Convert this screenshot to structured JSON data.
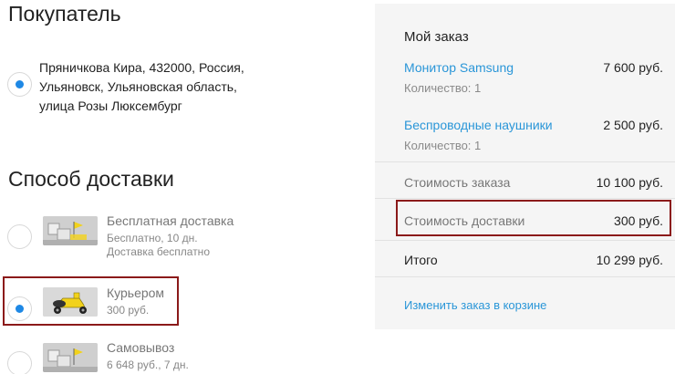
{
  "buyer": {
    "title": "Покупатель",
    "address": "Пряничкова Кира, 432000, Россия, Ульяновск, Ульяновская область, улица Розы Люксембург",
    "selected": true
  },
  "delivery": {
    "title": "Способ доставки",
    "options": [
      {
        "name": "Бесплатная доставка",
        "line1": "Бесплатно, 10 дн.",
        "line2": "Доставка бесплатно",
        "selected": false,
        "icon": "truck-cargo-icon"
      },
      {
        "name": "Курьером",
        "line1": "300 руб.",
        "selected": true,
        "icon": "scooter-icon"
      },
      {
        "name": "Самовывоз",
        "line1": "6 648 руб., 7 дн.",
        "selected": false,
        "icon": "truck-cargo-icon"
      }
    ]
  },
  "summary": {
    "heading": "Мой заказ",
    "items": [
      {
        "name": "Монитор Samsung",
        "qty": "Количество: 1",
        "price": "7 600 руб."
      },
      {
        "name": "Беспроводные наушники",
        "qty": "Количество: 1",
        "price": "2 500 руб."
      }
    ],
    "order_cost_label": "Стоимость заказа",
    "order_cost_value": "10 100 руб.",
    "delivery_cost_label": "Стоимость доставки",
    "delivery_cost_value": "300 руб.",
    "total_label": "Итого",
    "total_value": "10 299 руб.",
    "change_link": "Изменить заказ в корзине"
  },
  "colors": {
    "accent_blue": "#2a96d8",
    "radio_blue": "#1e88e5",
    "highlight_red": "#8b1a1a",
    "summary_bg": "#f5f5f5"
  }
}
